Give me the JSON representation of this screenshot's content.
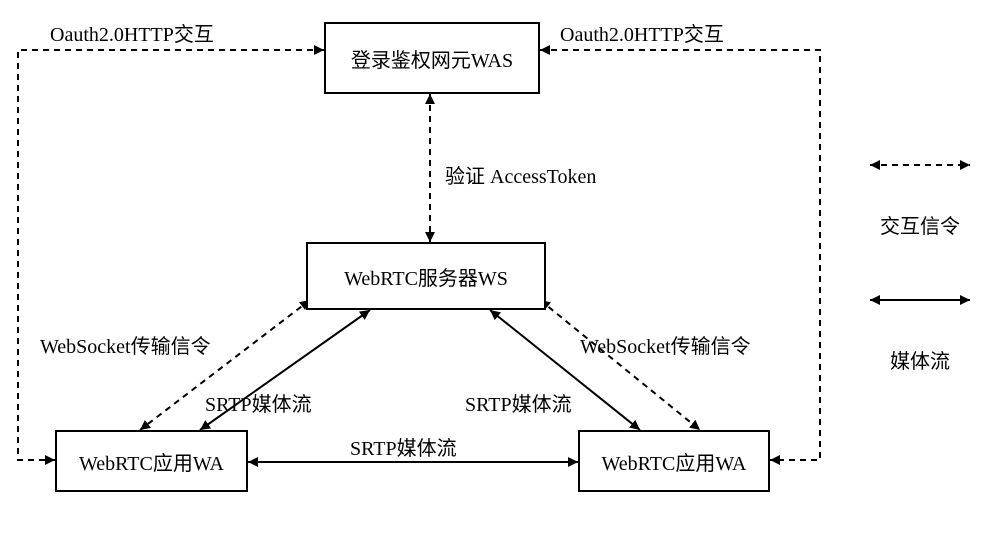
{
  "nodes": {
    "was": "登录鉴权网元WAS",
    "ws": "WebRTC服务器WS",
    "wa_left": "WebRTC应用WA",
    "wa_right": "WebRTC应用WA"
  },
  "edges": {
    "oauth_left": "Oauth2.0HTTP交互",
    "oauth_right": "Oauth2.0HTTP交互",
    "verify_token": "验证 AccessToken",
    "websocket_left": "WebSocket传输信令",
    "websocket_right": "WebSocket传输信令",
    "srtp_left": "SRTP媒体流",
    "srtp_right": "SRTP媒体流",
    "srtp_bottom": "SRTP媒体流"
  },
  "legend": {
    "signaling": "交互信令",
    "media": "媒体流"
  }
}
